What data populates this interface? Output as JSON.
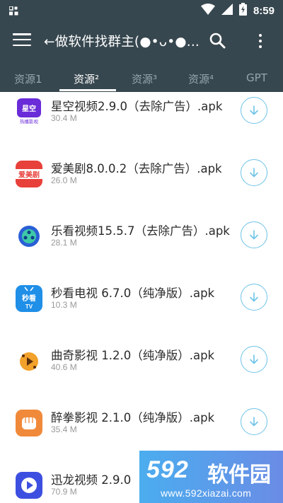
{
  "status_bar": {
    "time": "8:59",
    "icons": [
      "notification-grid-icon",
      "wifi-icon",
      "signal-icon",
      "battery-charging-icon"
    ]
  },
  "toolbar": {
    "title": "←做软件找群主(●•ᴗ•●...",
    "menu_icon": "hamburger-menu-icon",
    "search_icon": "search-icon",
    "more_icon": "more-vertical-icon"
  },
  "tabs": [
    {
      "label": "资源1",
      "active": false
    },
    {
      "label": "资源²",
      "active": true
    },
    {
      "label": "资源³",
      "active": false
    },
    {
      "label": "资源⁴",
      "active": false
    },
    {
      "label": "GPT",
      "active": false
    }
  ],
  "apps": [
    {
      "name": "星空视频2.9.0（去除广告）.apk",
      "size": "30.4 M",
      "icon": "xingkong-app-icon",
      "icon_color": "#6a2bd8",
      "icon_text": "星空",
      "icon_subtext": "热播影视"
    },
    {
      "name": "爱美剧8.0.0.2（去除广告）.apk",
      "size": "26.0 M",
      "icon": "aimeiju-app-icon",
      "icon_color": "#e8403a",
      "icon_text": "爱美剧"
    },
    {
      "name": "乐看视频15.5.7（去除广告）.apk",
      "size": "28.1 M",
      "icon": "lekan-app-icon",
      "icon_color": "#2a5fd6"
    },
    {
      "name": "秒看电视 6.7.0（纯净版）.apk",
      "size": "10.3 M",
      "icon": "miaokan-app-icon",
      "icon_color": "#1f8fe8",
      "icon_text": "秒看",
      "icon_subtext": "TV"
    },
    {
      "name": "曲奇影视 1.2.0（纯净版）.apk",
      "size": "40.6 M",
      "icon": "quqi-app-icon",
      "icon_color": "#f2a12a"
    },
    {
      "name": "醉拳影视 2.1.0（纯净版）.apk",
      "size": "35.4 M",
      "icon": "zuiquan-app-icon",
      "icon_color": "#f08a3a"
    },
    {
      "name": "迅龙视频 2.9.0",
      "size": "70.9 M",
      "icon": "xunlong-app-icon",
      "icon_color": "#3d4fe0"
    }
  ],
  "download_icon": "download-icon",
  "download_color": "#6ec3e8",
  "watermark": {
    "logo": "592",
    "logo_cn": "软件园",
    "url": "www.592xiazai.com"
  }
}
